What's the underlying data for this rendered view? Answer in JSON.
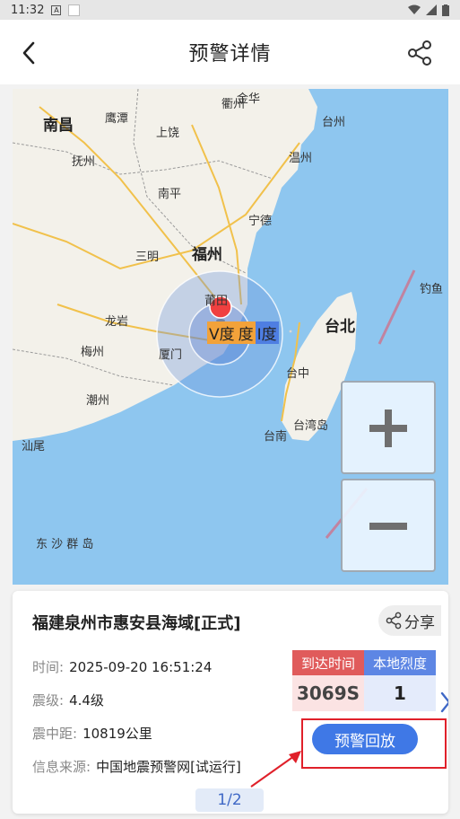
{
  "status_bar": {
    "time": "11:32",
    "icon_a": "A"
  },
  "header": {
    "title": "预警详情",
    "back_icon": "chevron-left-icon",
    "share_icon": "share-icon"
  },
  "map": {
    "cities": {
      "nanchang": "南昌",
      "yingtan": "鹰潭",
      "quzhou": "衢州",
      "jinhua": "金华",
      "taizhou": "台州",
      "shangrao": "上饶",
      "fuzhou_jx": "抚州",
      "wenzhou": "温州",
      "nanping": "南平",
      "ningde": "宁德",
      "sanming": "三明",
      "fuzhou": "福州",
      "diaoyu": "钓鱼",
      "putian": "莆田",
      "longyan": "龙岩",
      "taibei": "台北",
      "meizhou": "梅州",
      "xiamen": "厦门",
      "taizhong": "台中",
      "chaozhou": "潮州",
      "taiwandao": "台湾岛",
      "tainan": "台南",
      "shanwei": "汕尾",
      "dongsha": "东 沙 群 岛"
    },
    "intensity_left": "V度",
    "intensity_mid": "度",
    "intensity_right": "I度",
    "zoom_in_icon": "plus-icon",
    "zoom_out_icon": "minus-icon"
  },
  "card": {
    "title": "福建泉州市惠安县海域[正式]",
    "share_label": "分享",
    "time_label": "时间:",
    "time_value": "2025-09-20 16:51:24",
    "magnitude_label": "震级:",
    "magnitude_value": "4.4级",
    "distance_label": "震中距:",
    "distance_value": "10819公里",
    "source_label": "信息来源:",
    "source_value": "中国地震预警网[试运行]",
    "arrival_header": "到达时间",
    "local_intensity_header": "本地烈度",
    "arrival_value": "3069S",
    "local_intensity_value": "1",
    "replay_label": "预警回放",
    "page_indicator": "1/2"
  },
  "colors": {
    "accent": "#3f78e6",
    "red": "#e05b5b",
    "annotation": "#e0202a"
  }
}
